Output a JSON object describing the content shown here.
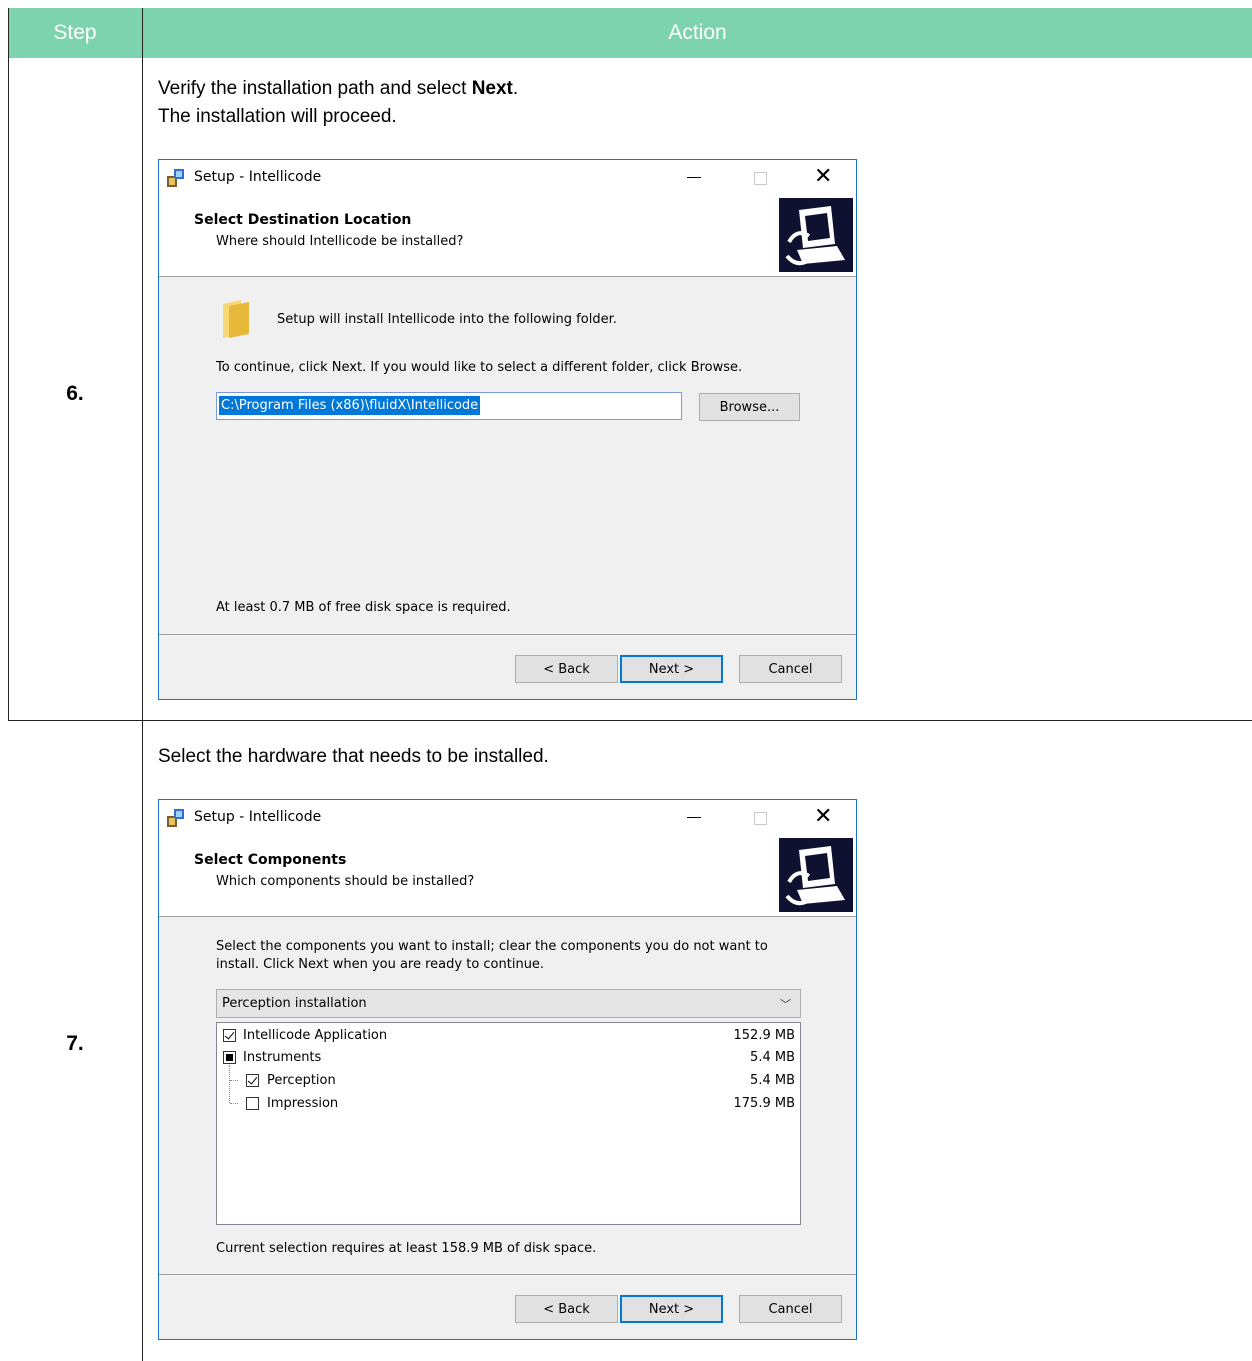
{
  "table": {
    "header_step": "Step",
    "header_action": "Action"
  },
  "steps": [
    {
      "number": "6.",
      "instruction_line1_prefix": "Verify the installation path and select ",
      "instruction_line1_bold": "Next",
      "instruction_line1_suffix": ".",
      "instruction_line2": "The installation will proceed.",
      "dialog": {
        "window_title": "Setup - Intellicode",
        "page_title": "Select Destination Location",
        "page_subtitle": "Where should Intellicode be installed?",
        "folder_message": "Setup will install Intellicode into the following folder.",
        "continue_message": "To continue, click Next. If you would like to select a different folder, click Browse.",
        "path_value": "C:\\Program Files (x86)\\fluidX\\Intellicode",
        "browse_label": "Browse...",
        "disk_space": "At least 0.7 MB of free disk space is required.",
        "back_label": "< Back",
        "next_label": "Next >",
        "cancel_label": "Cancel"
      }
    },
    {
      "number": "7.",
      "instruction_line1": "Select the hardware that needs to be installed.",
      "dialog": {
        "window_title": "Setup - Intellicode",
        "page_title": "Select Components",
        "page_subtitle": "Which components should be installed?",
        "description_line1": "Select the components you want to install; clear the components you do not want to",
        "description_line2": "install. Click Next when you are ready to continue.",
        "install_type": "Perception installation",
        "components": [
          {
            "label": "Intellicode Application",
            "size": "152.9 MB",
            "state": "checked"
          },
          {
            "label": "Instruments",
            "size": "5.4 MB",
            "state": "partial"
          },
          {
            "label": "Perception",
            "size": "5.4 MB",
            "state": "checked"
          },
          {
            "label": "Impression",
            "size": "175.9 MB",
            "state": "unchecked"
          }
        ],
        "disk_space": "Current selection requires at least 158.9 MB of disk space.",
        "back_label": "< Back",
        "next_label": "Next >",
        "cancel_label": "Cancel"
      }
    }
  ],
  "colors": {
    "header_bg": "#7dd3ae",
    "dialog_border": "#1a73c8",
    "selection": "#0078d7"
  }
}
